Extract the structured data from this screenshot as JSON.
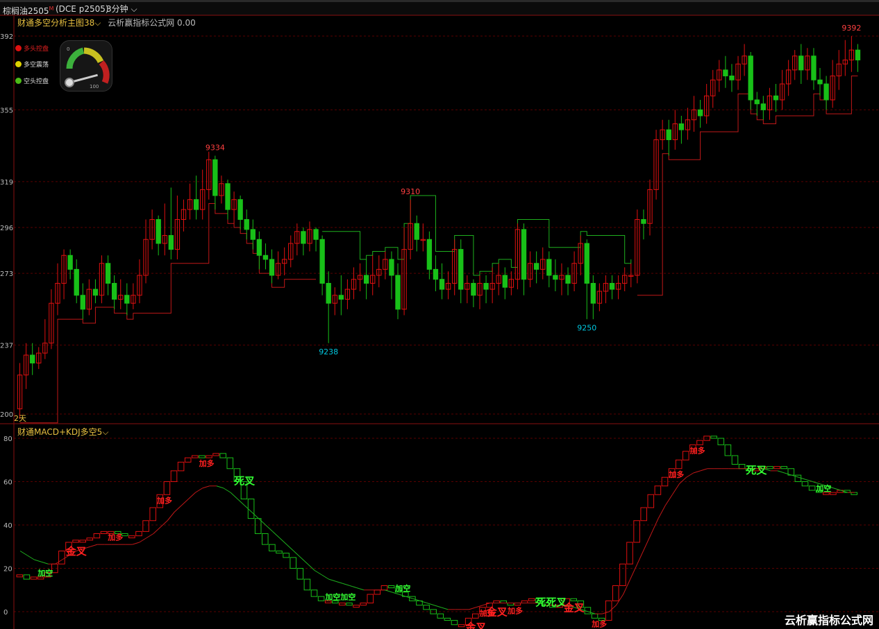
{
  "header": {
    "symbol": "棕榈油2505",
    "symbol_mark": "M",
    "contract": "(DCE p2505)",
    "period": "3分钟"
  },
  "main_panel": {
    "title": "财通多空分析主图38",
    "subtitle": "云析赢指标公式网 0.00",
    "days_label": "2天",
    "legend": [
      {
        "label": "多头控盘",
        "color": "#e01010"
      },
      {
        "label": "多空震荡",
        "color": "#e0d000"
      },
      {
        "label": "空头控盘",
        "color": "#4cbb17"
      }
    ],
    "gauge": {
      "min_label": "0",
      "max_label": "100",
      "value": 0.05
    },
    "y_ticks": [
      "392",
      "355",
      "319",
      "296",
      "273",
      "237",
      "200"
    ],
    "annotations": [
      {
        "text": "9334",
        "color": "#ff4040"
      },
      {
        "text": "9310",
        "color": "#ff4040"
      },
      {
        "text": "9392",
        "color": "#ff4040"
      },
      {
        "text": "9238",
        "color": "#00c8e0"
      },
      {
        "text": "9250",
        "color": "#00c8e0"
      }
    ]
  },
  "sub_panel": {
    "title": "财通MACD+KDJ多空5",
    "y_ticks": [
      "80",
      "60",
      "40",
      "20",
      "0"
    ],
    "signals": [
      {
        "text": "加空",
        "color": "#33ff33"
      },
      {
        "text": "金叉",
        "color": "#ff2020"
      },
      {
        "text": "加多",
        "color": "#ff2020"
      },
      {
        "text": "加多",
        "color": "#ff2020"
      },
      {
        "text": "加多",
        "color": "#ff2020"
      },
      {
        "text": "死叉",
        "color": "#33ff33"
      },
      {
        "text": "加空加空",
        "color": "#33ff33"
      },
      {
        "text": "加空",
        "color": "#33ff33"
      },
      {
        "text": "金叉",
        "color": "#ff2020"
      },
      {
        "text": "加多",
        "color": "#ff2020"
      },
      {
        "text": "加多",
        "color": "#ff2020"
      },
      {
        "text": "死死叉",
        "color": "#33ff33"
      },
      {
        "text": "金叉",
        "color": "#ff2020"
      },
      {
        "text": "金叉",
        "color": "#ff2020"
      },
      {
        "text": "加多",
        "color": "#ff2020"
      },
      {
        "text": "加多",
        "color": "#ff2020"
      },
      {
        "text": "加多",
        "color": "#ff2020"
      },
      {
        "text": "死叉",
        "color": "#33ff33"
      },
      {
        "text": "加空",
        "color": "#33ff33"
      }
    ]
  },
  "watermark": "云析赢指标公式网",
  "colors": {
    "up": "#e01010",
    "down": "#18c018",
    "grid": "#5a0000",
    "step_red": "#c01818",
    "step_green": "#1eb01e"
  },
  "chart_data": {
    "type": "candlestick",
    "y_axis_ticks": [
      9200,
      9237,
      9273,
      9296,
      9319,
      9355,
      9392
    ],
    "ylim": [
      9200,
      9400
    ],
    "candles": [
      [
        9205,
        9222,
        9200,
        9228
      ],
      [
        9222,
        9232,
        9215,
        9238
      ],
      [
        9232,
        9228,
        9222,
        9238
      ],
      [
        9228,
        9233,
        9225,
        9236
      ],
      [
        9233,
        9238,
        9230,
        9250
      ],
      [
        9238,
        9258,
        9235,
        9265
      ],
      [
        9258,
        9268,
        9252,
        9278
      ],
      [
        9268,
        9282,
        9260,
        9285
      ],
      [
        9282,
        9275,
        9270,
        9285
      ],
      [
        9275,
        9262,
        9258,
        9280
      ],
      [
        9262,
        9255,
        9250,
        9268
      ],
      [
        9255,
        9265,
        9252,
        9270
      ],
      [
        9265,
        9262,
        9258,
        9270
      ],
      [
        9262,
        9278,
        9258,
        9282
      ],
      [
        9278,
        9268,
        9262,
        9282
      ],
      [
        9268,
        9260,
        9255,
        9272
      ],
      [
        9260,
        9262,
        9255,
        9270
      ],
      [
        9262,
        9258,
        9252,
        9268
      ],
      [
        9258,
        9262,
        9255,
        9268
      ],
      [
        9262,
        9272,
        9258,
        9280
      ],
      [
        9272,
        9290,
        9268,
        9300
      ],
      [
        9290,
        9300,
        9285,
        9305
      ],
      [
        9300,
        9288,
        9282,
        9302
      ],
      [
        9288,
        9292,
        9282,
        9308
      ],
      [
        9292,
        9285,
        9280,
        9316
      ],
      [
        9285,
        9300,
        9280,
        9312
      ],
      [
        9300,
        9305,
        9294,
        9310
      ],
      [
        9305,
        9310,
        9300,
        9318
      ],
      [
        9310,
        9305,
        9300,
        9322
      ],
      [
        9305,
        9315,
        9300,
        9325
      ],
      [
        9315,
        9330,
        9310,
        9334
      ],
      [
        9330,
        9312,
        9305,
        9332
      ],
      [
        9312,
        9318,
        9308,
        9322
      ],
      [
        9318,
        9305,
        9300,
        9320
      ],
      [
        9305,
        9310,
        9298,
        9314
      ],
      [
        9310,
        9300,
        9295,
        9312
      ],
      [
        9300,
        9295,
        9290,
        9305
      ],
      [
        9295,
        9290,
        9285,
        9300
      ],
      [
        9290,
        9282,
        9275,
        9294
      ],
      [
        9282,
        9280,
        9275,
        9288
      ],
      [
        9280,
        9272,
        9268,
        9285
      ],
      [
        9272,
        9278,
        9270,
        9284
      ],
      [
        9278,
        9280,
        9272,
        9286
      ],
      [
        9280,
        9288,
        9276,
        9292
      ],
      [
        9288,
        9294,
        9282,
        9298
      ],
      [
        9294,
        9288,
        9282,
        9296
      ],
      [
        9288,
        9295,
        9284,
        9299
      ],
      [
        9295,
        9290,
        9284,
        9296
      ],
      [
        9290,
        9268,
        9262,
        9292
      ],
      [
        9268,
        9258,
        9238,
        9274
      ],
      [
        9258,
        9262,
        9252,
        9266
      ],
      [
        9262,
        9260,
        9252,
        9272
      ],
      [
        9260,
        9265,
        9255,
        9270
      ],
      [
        9265,
        9270,
        9260,
        9276
      ],
      [
        9270,
        9272,
        9264,
        9278
      ],
      [
        9272,
        9268,
        9260,
        9280
      ],
      [
        9268,
        9272,
        9262,
        9282
      ],
      [
        9272,
        9275,
        9266,
        9282
      ],
      [
        9275,
        9280,
        9270,
        9284
      ],
      [
        9280,
        9272,
        9260,
        9284
      ],
      [
        9272,
        9255,
        9250,
        9278
      ],
      [
        9255,
        9285,
        9252,
        9296
      ],
      [
        9285,
        9298,
        9280,
        9310
      ],
      [
        9298,
        9290,
        9284,
        9302
      ],
      [
        9290,
        9290,
        9284,
        9298
      ],
      [
        9290,
        9275,
        9270,
        9294
      ],
      [
        9275,
        9270,
        9264,
        9282
      ],
      [
        9270,
        9265,
        9260,
        9278
      ],
      [
        9265,
        9268,
        9260,
        9274
      ],
      [
        9268,
        9285,
        9262,
        9290
      ],
      [
        9285,
        9265,
        9258,
        9290
      ],
      [
        9265,
        9268,
        9258,
        9272
      ],
      [
        9268,
        9262,
        9256,
        9270
      ],
      [
        9262,
        9268,
        9255,
        9272
      ],
      [
        9268,
        9265,
        9258,
        9272
      ],
      [
        9265,
        9268,
        9258,
        9276
      ],
      [
        9268,
        9272,
        9262,
        9278
      ],
      [
        9272,
        9266,
        9260,
        9276
      ],
      [
        9266,
        9270,
        9262,
        9274
      ],
      [
        9270,
        9295,
        9265,
        9298
      ],
      [
        9295,
        9270,
        9262,
        9298
      ],
      [
        9270,
        9278,
        9266,
        9284
      ],
      [
        9278,
        9275,
        9268,
        9284
      ],
      [
        9275,
        9280,
        9270,
        9286
      ],
      [
        9280,
        9272,
        9266,
        9284
      ],
      [
        9272,
        9270,
        9264,
        9280
      ],
      [
        9270,
        9272,
        9262,
        9278
      ],
      [
        9272,
        9268,
        9262,
        9276
      ],
      [
        9268,
        9278,
        9264,
        9284
      ],
      [
        9278,
        9288,
        9272,
        9292
      ],
      [
        9288,
        9268,
        9250,
        9290
      ],
      [
        9268,
        9258,
        9250,
        9272
      ],
      [
        9258,
        9264,
        9254,
        9268
      ],
      [
        9264,
        9268,
        9258,
        9272
      ],
      [
        9268,
        9265,
        9260,
        9272
      ],
      [
        9265,
        9268,
        9260,
        9272
      ],
      [
        9268,
        9272,
        9264,
        9276
      ],
      [
        9272,
        9272,
        9266,
        9278
      ],
      [
        9272,
        9300,
        9268,
        9305
      ],
      [
        9300,
        9298,
        9290,
        9305
      ],
      [
        9298,
        9315,
        9292,
        9320
      ],
      [
        9315,
        9340,
        9310,
        9345
      ],
      [
        9340,
        9345,
        9335,
        9350
      ],
      [
        9345,
        9340,
        9332,
        9350
      ],
      [
        9340,
        9348,
        9335,
        9355
      ],
      [
        9348,
        9345,
        9338,
        9352
      ],
      [
        9345,
        9350,
        9340,
        9356
      ],
      [
        9350,
        9355,
        9344,
        9362
      ],
      [
        9355,
        9352,
        9346,
        9360
      ],
      [
        9352,
        9362,
        9348,
        9368
      ],
      [
        9362,
        9370,
        9356,
        9375
      ],
      [
        9370,
        9375,
        9364,
        9380
      ],
      [
        9375,
        9372,
        9366,
        9382
      ],
      [
        9372,
        9370,
        9364,
        9378
      ],
      [
        9370,
        9378,
        9365,
        9382
      ],
      [
        9378,
        9382,
        9372,
        9388
      ],
      [
        9382,
        9360,
        9355,
        9384
      ],
      [
        9360,
        9358,
        9352,
        9364
      ],
      [
        9358,
        9355,
        9350,
        9362
      ],
      [
        9355,
        9362,
        9350,
        9366
      ],
      [
        9362,
        9360,
        9354,
        9368
      ],
      [
        9360,
        9368,
        9355,
        9375
      ],
      [
        9368,
        9375,
        9362,
        9380
      ],
      [
        9375,
        9382,
        9370,
        9385
      ],
      [
        9382,
        9375,
        9368,
        9388
      ],
      [
        9375,
        9382,
        9370,
        9386
      ],
      [
        9382,
        9370,
        9365,
        9386
      ],
      [
        9370,
        9368,
        9362,
        9376
      ],
      [
        9368,
        9360,
        9355,
        9372
      ],
      [
        9360,
        9372,
        9356,
        9380
      ],
      [
        9372,
        9378,
        9365,
        9385
      ],
      [
        9378,
        9380,
        9372,
        9390
      ],
      [
        9380,
        9385,
        9374,
        9392
      ],
      [
        9385,
        9380,
        9374,
        9388
      ]
    ],
    "oscillator": {
      "ylim": [
        -5,
        85
      ],
      "y_ticks": [
        0,
        20,
        40,
        60,
        80
      ],
      "k": [
        17,
        15,
        16,
        16,
        18,
        22,
        28,
        32,
        33,
        33,
        34,
        36,
        37,
        37,
        36,
        35,
        35,
        37,
        42,
        48,
        54,
        60,
        65,
        69,
        71,
        72,
        71,
        72,
        73,
        71,
        66,
        60,
        52,
        43,
        36,
        31,
        28,
        27,
        25,
        20,
        15,
        10,
        7,
        5,
        5,
        4,
        4,
        3,
        3,
        4,
        8,
        10,
        12,
        11,
        9,
        7,
        5,
        3,
        1,
        -1,
        -3,
        -4,
        -6,
        -6,
        -3,
        -1,
        2,
        4,
        5,
        4,
        3,
        4,
        5,
        6,
        4,
        3,
        2,
        3,
        6,
        5,
        2,
        -1,
        -3,
        -4,
        5,
        12,
        22,
        32,
        42,
        48,
        54,
        58,
        62,
        66,
        70,
        74,
        77,
        79,
        81,
        80,
        77,
        72,
        68,
        66,
        65,
        66,
        67,
        66,
        67,
        66,
        63,
        60,
        58,
        56,
        55,
        55,
        55,
        56,
        55,
        54
      ],
      "signal": [
        28,
        26,
        24,
        23,
        22,
        22,
        24,
        26,
        28,
        29,
        30,
        31,
        31,
        31,
        31,
        31,
        31,
        32,
        34,
        36,
        39,
        42,
        46,
        49,
        52,
        55,
        57,
        58,
        58,
        57,
        55,
        52,
        49,
        46,
        43,
        40,
        37,
        34,
        31,
        28,
        25,
        22,
        19,
        17,
        15,
        14,
        13,
        12,
        11,
        10,
        10,
        10,
        10,
        9,
        8,
        7,
        6,
        5,
        4,
        3,
        2,
        1,
        1,
        1,
        1,
        2,
        3,
        4,
        4,
        4,
        4,
        4,
        4,
        4,
        4,
        3,
        3,
        3,
        3,
        2,
        1,
        0,
        -1,
        -1,
        0,
        3,
        8,
        15,
        22,
        29,
        36,
        43,
        49,
        54,
        59,
        62,
        64,
        65,
        66,
        66,
        66,
        66,
        66,
        66,
        66,
        66,
        66,
        65,
        65,
        64,
        63,
        62,
        61,
        60,
        59,
        58,
        57,
        56,
        55,
        55
      ]
    }
  }
}
